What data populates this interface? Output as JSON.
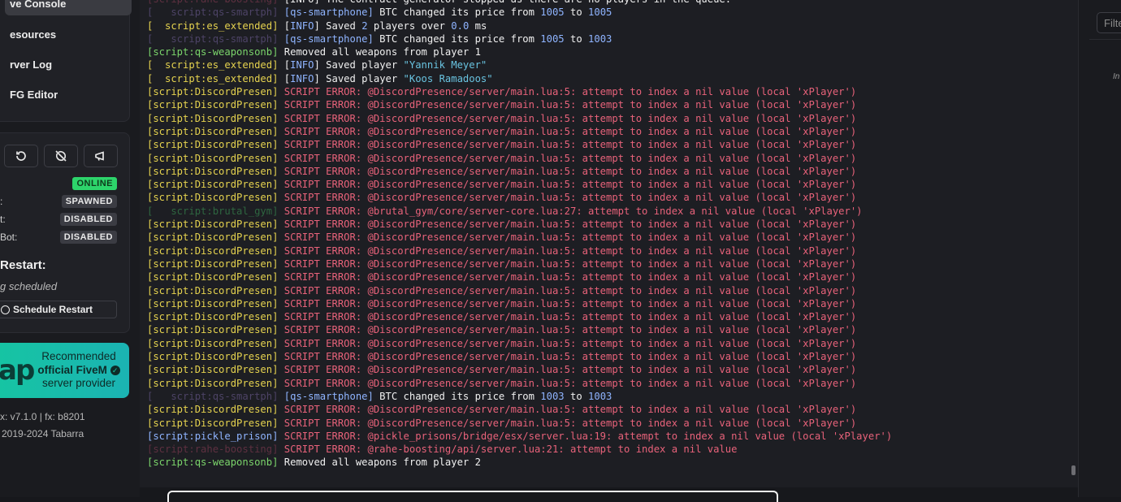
{
  "sidebar": {
    "nav": [
      {
        "label": "ve Console",
        "active": true
      },
      {
        "label": "esources"
      },
      {
        "label": "rver Log"
      },
      {
        "label": "FG Editor"
      }
    ],
    "controls": {
      "buttons": [
        {
          "icon": "restart-icon"
        },
        {
          "icon": "stop-icon"
        },
        {
          "icon": "announce-icon"
        }
      ],
      "status": [
        {
          "label": "",
          "value": "ONLINE"
        },
        {
          "label": ":",
          "value": "SPAWNED"
        },
        {
          "label": "t:",
          "value": "DISABLED"
        },
        {
          "label": "Bot:",
          "value": "DISABLED"
        }
      ],
      "restart_title": "Restart:",
      "restart_subtitle": "g scheduled",
      "schedule_button": "Schedule Restart"
    },
    "promo": {
      "logo": "ap",
      "line1": "Recommended",
      "line2": "official FiveM",
      "line3": "server provider"
    },
    "footer": {
      "version": "x: v7.1.0 | fx: b8201",
      "copyright": "2019-2024 Tabarra"
    }
  },
  "right_panel": {
    "filter_placeholder": "Filte",
    "note": "In"
  },
  "colors": {
    "online": "#2dd46b",
    "error": "#e8627a",
    "tag_yellow": "#e6d34f",
    "tag_green": "#7bd56b",
    "accent_blue": "#8fb4ff",
    "promo": "#16c5a2"
  },
  "console": {
    "lines": [
      {
        "tag": "[script:rahe-boosting]",
        "tag_style": "dimred",
        "segments": [
          {
            "t": "[INFO] The contract generator stopped as there are no players in the queue.",
            "s": "white"
          }
        ]
      },
      {
        "tag": "[   script:qs-smartph]",
        "tag_style": "dimpurple",
        "segments": [
          {
            "t": "[qs-smartphone]",
            "s": "blue"
          },
          {
            "t": " BTC changed its price from ",
            "s": "white"
          },
          {
            "t": "1005",
            "s": "num"
          },
          {
            "t": " to ",
            "s": "white"
          },
          {
            "t": "1005",
            "s": "num"
          }
        ]
      },
      {
        "tag": "[  script:es_extended]",
        "tag_style": "yellow",
        "segments": [
          {
            "t": "[",
            "s": "white"
          },
          {
            "t": "INFO",
            "s": "blue"
          },
          {
            "t": "] Saved ",
            "s": "white"
          },
          {
            "t": "2",
            "s": "num"
          },
          {
            "t": " players over ",
            "s": "white"
          },
          {
            "t": "0.0",
            "s": "num"
          },
          {
            "t": " ms",
            "s": "white"
          }
        ]
      },
      {
        "tag": "[   script:qs-smartph]",
        "tag_style": "dimpurple",
        "segments": [
          {
            "t": "[qs-smartphone]",
            "s": "blue"
          },
          {
            "t": " BTC changed its price from ",
            "s": "white"
          },
          {
            "t": "1005",
            "s": "num"
          },
          {
            "t": " to ",
            "s": "white"
          },
          {
            "t": "1003",
            "s": "num"
          }
        ]
      },
      {
        "tag": "[script:qs-weaponsonb]",
        "tag_style": "green",
        "segments": [
          {
            "t": "Removed all weapons from player 1",
            "s": "white"
          }
        ]
      },
      {
        "tag": "[  script:es_extended]",
        "tag_style": "yellow",
        "segments": [
          {
            "t": "[",
            "s": "white"
          },
          {
            "t": "INFO",
            "s": "blue"
          },
          {
            "t": "] Saved player ",
            "s": "white"
          },
          {
            "t": "\"Yannik Meyer\"",
            "s": "str"
          }
        ]
      },
      {
        "tag": "[  script:es_extended]",
        "tag_style": "yellow",
        "segments": [
          {
            "t": "[",
            "s": "white"
          },
          {
            "t": "INFO",
            "s": "blue"
          },
          {
            "t": "] Saved player ",
            "s": "white"
          },
          {
            "t": "\"Koos Ramadoos\"",
            "s": "str"
          }
        ]
      },
      {
        "tag": "[script:DiscordPresen]",
        "tag_style": "yellow",
        "segments": [
          {
            "t": "SCRIPT ERROR: @DiscordPresence/server/main.lua:5: attempt to index a nil value (local 'xPlayer')",
            "s": "red"
          }
        ]
      },
      {
        "tag": "[script:DiscordPresen]",
        "tag_style": "yellow",
        "segments": [
          {
            "t": "SCRIPT ERROR: @DiscordPresence/server/main.lua:5: attempt to index a nil value (local 'xPlayer')",
            "s": "red"
          }
        ]
      },
      {
        "tag": "[script:DiscordPresen]",
        "tag_style": "yellow",
        "segments": [
          {
            "t": "SCRIPT ERROR: @DiscordPresence/server/main.lua:5: attempt to index a nil value (local 'xPlayer')",
            "s": "red"
          }
        ]
      },
      {
        "tag": "[script:DiscordPresen]",
        "tag_style": "yellow",
        "segments": [
          {
            "t": "SCRIPT ERROR: @DiscordPresence/server/main.lua:5: attempt to index a nil value (local 'xPlayer')",
            "s": "red"
          }
        ]
      },
      {
        "tag": "[script:DiscordPresen]",
        "tag_style": "yellow",
        "segments": [
          {
            "t": "SCRIPT ERROR: @DiscordPresence/server/main.lua:5: attempt to index a nil value (local 'xPlayer')",
            "s": "red"
          }
        ]
      },
      {
        "tag": "[script:DiscordPresen]",
        "tag_style": "yellow",
        "segments": [
          {
            "t": "SCRIPT ERROR: @DiscordPresence/server/main.lua:5: attempt to index a nil value (local 'xPlayer')",
            "s": "red"
          }
        ]
      },
      {
        "tag": "[script:DiscordPresen]",
        "tag_style": "yellow",
        "segments": [
          {
            "t": "SCRIPT ERROR: @DiscordPresence/server/main.lua:5: attempt to index a nil value (local 'xPlayer')",
            "s": "red"
          }
        ]
      },
      {
        "tag": "[script:DiscordPresen]",
        "tag_style": "yellow",
        "segments": [
          {
            "t": "SCRIPT ERROR: @DiscordPresence/server/main.lua:5: attempt to index a nil value (local 'xPlayer')",
            "s": "red"
          }
        ]
      },
      {
        "tag": "[script:DiscordPresen]",
        "tag_style": "yellow",
        "segments": [
          {
            "t": "SCRIPT ERROR: @DiscordPresence/server/main.lua:5: attempt to index a nil value (local 'xPlayer')",
            "s": "red"
          }
        ]
      },
      {
        "tag": "[   script:brutal_gym]",
        "tag_style": "dimgreen",
        "segments": [
          {
            "t": "SCRIPT ERROR: @brutal_gym/core/server-core.lua:27: attempt to index a nil value (local 'xPlayer')",
            "s": "red"
          }
        ]
      },
      {
        "tag": "[script:DiscordPresen]",
        "tag_style": "yellow",
        "segments": [
          {
            "t": "SCRIPT ERROR: @DiscordPresence/server/main.lua:5: attempt to index a nil value (local 'xPlayer')",
            "s": "red"
          }
        ]
      },
      {
        "tag": "[script:DiscordPresen]",
        "tag_style": "yellow",
        "segments": [
          {
            "t": "SCRIPT ERROR: @DiscordPresence/server/main.lua:5: attempt to index a nil value (local 'xPlayer')",
            "s": "red"
          }
        ]
      },
      {
        "tag": "[script:DiscordPresen]",
        "tag_style": "yellow",
        "segments": [
          {
            "t": "SCRIPT ERROR: @DiscordPresence/server/main.lua:5: attempt to index a nil value (local 'xPlayer')",
            "s": "red"
          }
        ]
      },
      {
        "tag": "[script:DiscordPresen]",
        "tag_style": "yellow",
        "segments": [
          {
            "t": "SCRIPT ERROR: @DiscordPresence/server/main.lua:5: attempt to index a nil value (local 'xPlayer')",
            "s": "red"
          }
        ]
      },
      {
        "tag": "[script:DiscordPresen]",
        "tag_style": "yellow",
        "segments": [
          {
            "t": "SCRIPT ERROR: @DiscordPresence/server/main.lua:5: attempt to index a nil value (local 'xPlayer')",
            "s": "red"
          }
        ]
      },
      {
        "tag": "[script:DiscordPresen]",
        "tag_style": "yellow",
        "segments": [
          {
            "t": "SCRIPT ERROR: @DiscordPresence/server/main.lua:5: attempt to index a nil value (local 'xPlayer')",
            "s": "red"
          }
        ]
      },
      {
        "tag": "[script:DiscordPresen]",
        "tag_style": "yellow",
        "segments": [
          {
            "t": "SCRIPT ERROR: @DiscordPresence/server/main.lua:5: attempt to index a nil value (local 'xPlayer')",
            "s": "red"
          }
        ]
      },
      {
        "tag": "[script:DiscordPresen]",
        "tag_style": "yellow",
        "segments": [
          {
            "t": "SCRIPT ERROR: @DiscordPresence/server/main.lua:5: attempt to index a nil value (local 'xPlayer')",
            "s": "red"
          }
        ]
      },
      {
        "tag": "[script:DiscordPresen]",
        "tag_style": "yellow",
        "segments": [
          {
            "t": "SCRIPT ERROR: @DiscordPresence/server/main.lua:5: attempt to index a nil value (local 'xPlayer')",
            "s": "red"
          }
        ]
      },
      {
        "tag": "[script:DiscordPresen]",
        "tag_style": "yellow",
        "segments": [
          {
            "t": "SCRIPT ERROR: @DiscordPresence/server/main.lua:5: attempt to index a nil value (local 'xPlayer')",
            "s": "red"
          }
        ]
      },
      {
        "tag": "[script:DiscordPresen]",
        "tag_style": "yellow",
        "segments": [
          {
            "t": "SCRIPT ERROR: @DiscordPresence/server/main.lua:5: attempt to index a nil value (local 'xPlayer')",
            "s": "red"
          }
        ]
      },
      {
        "tag": "[script:DiscordPresen]",
        "tag_style": "yellow",
        "segments": [
          {
            "t": "SCRIPT ERROR: @DiscordPresence/server/main.lua:5: attempt to index a nil value (local 'xPlayer')",
            "s": "red"
          }
        ]
      },
      {
        "tag": "[script:DiscordPresen]",
        "tag_style": "yellow",
        "segments": [
          {
            "t": "SCRIPT ERROR: @DiscordPresence/server/main.lua:5: attempt to index a nil value (local 'xPlayer')",
            "s": "red"
          }
        ]
      },
      {
        "tag": "[   script:qs-smartph]",
        "tag_style": "dimpurple",
        "segments": [
          {
            "t": "[qs-smartphone]",
            "s": "blue"
          },
          {
            "t": " BTC changed its price from ",
            "s": "white"
          },
          {
            "t": "1003",
            "s": "num"
          },
          {
            "t": " to ",
            "s": "white"
          },
          {
            "t": "1003",
            "s": "num"
          }
        ]
      },
      {
        "tag": "[script:DiscordPresen]",
        "tag_style": "yellow",
        "segments": [
          {
            "t": "SCRIPT ERROR: @DiscordPresence/server/main.lua:5: attempt to index a nil value (local 'xPlayer')",
            "s": "red"
          }
        ]
      },
      {
        "tag": "[script:DiscordPresen]",
        "tag_style": "yellow",
        "segments": [
          {
            "t": "SCRIPT ERROR: @DiscordPresence/server/main.lua:5: attempt to index a nil value (local 'xPlayer')",
            "s": "red"
          }
        ]
      },
      {
        "tag": "[script:pickle_prison]",
        "tag_style": "blue",
        "segments": [
          {
            "t": "SCRIPT ERROR: @pickle_prisons/bridge/esx/server.lua:19: attempt to index a nil value (local 'xPlayer')",
            "s": "red"
          }
        ]
      },
      {
        "tag": "[script:rahe-boosting]",
        "tag_style": "dimred",
        "segments": [
          {
            "t": "SCRIPT ERROR: @rahe-boosting/api/server.lua:21: attempt to index a nil value",
            "s": "red"
          }
        ]
      },
      {
        "tag": "[script:qs-weaponsonb]",
        "tag_style": "green",
        "segments": [
          {
            "t": "Removed all weapons from player 2",
            "s": "white"
          }
        ]
      }
    ]
  }
}
